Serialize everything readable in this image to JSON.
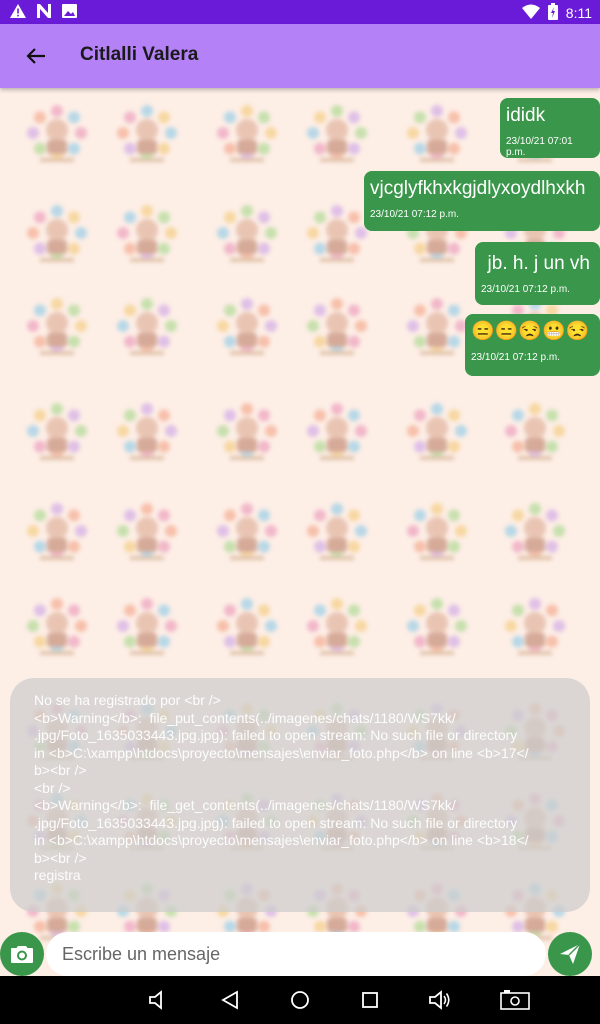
{
  "status_bar": {
    "time": "8:11",
    "left_icons": [
      "alert-icon",
      "n-app-icon",
      "image-icon"
    ],
    "right_icons": [
      "wifi-icon",
      "battery-icon"
    ]
  },
  "header": {
    "contact_name": "Citlalli Valera"
  },
  "messages": [
    {
      "text": "ididk",
      "time": "23/10/21 07:01 p.m."
    },
    {
      "text": "vjcglyfkhxkgjdlyxoydlhxkh",
      "time": "23/10/21 07:12 p.m."
    },
    {
      "text": "jb. h. j un vh",
      "time": "23/10/21 07:12 p.m."
    },
    {
      "text": "😑😑😒😬😒",
      "time": "23/10/21 07:12 p.m."
    }
  ],
  "error_message": "No se ha registrado por <br />\n<b>Warning</b>:  file_put_contents(../imagenes/chats/1180/WS7kk/\n.jpg/Foto_1635033443.jpg.jpg): failed to open stream: No such file or directory\nin <b>C:\\xampp\\htdocs\\proyecto\\mensajes\\enviar_foto.php</b> on line <b>17</\nb><br />\n<br />\n<b>Warning</b>:  file_get_contents(../imagenes/chats/1180/WS7kk/\n.jpg/Foto_1635033443.jpg.jpg): failed to open stream: No such file or directory\nin <b>C:\\xampp\\htdocs\\proyecto\\mensajes\\enviar_foto.php</b> on line <b>18</\nb><br />\nregistra",
  "composer": {
    "placeholder": "Escribe un mensaje",
    "camera_icon": "camera-icon",
    "send_icon": "send-icon"
  },
  "colors": {
    "status_bar": "#6a1bd8",
    "app_bar": "#b481f7",
    "bubble": "#3a964a",
    "background": "#fdeee6"
  },
  "nav_bar_icons": [
    "volume-down-icon",
    "back-icon",
    "home-icon",
    "recents-icon",
    "volume-up-icon",
    "screenshot-icon"
  ]
}
